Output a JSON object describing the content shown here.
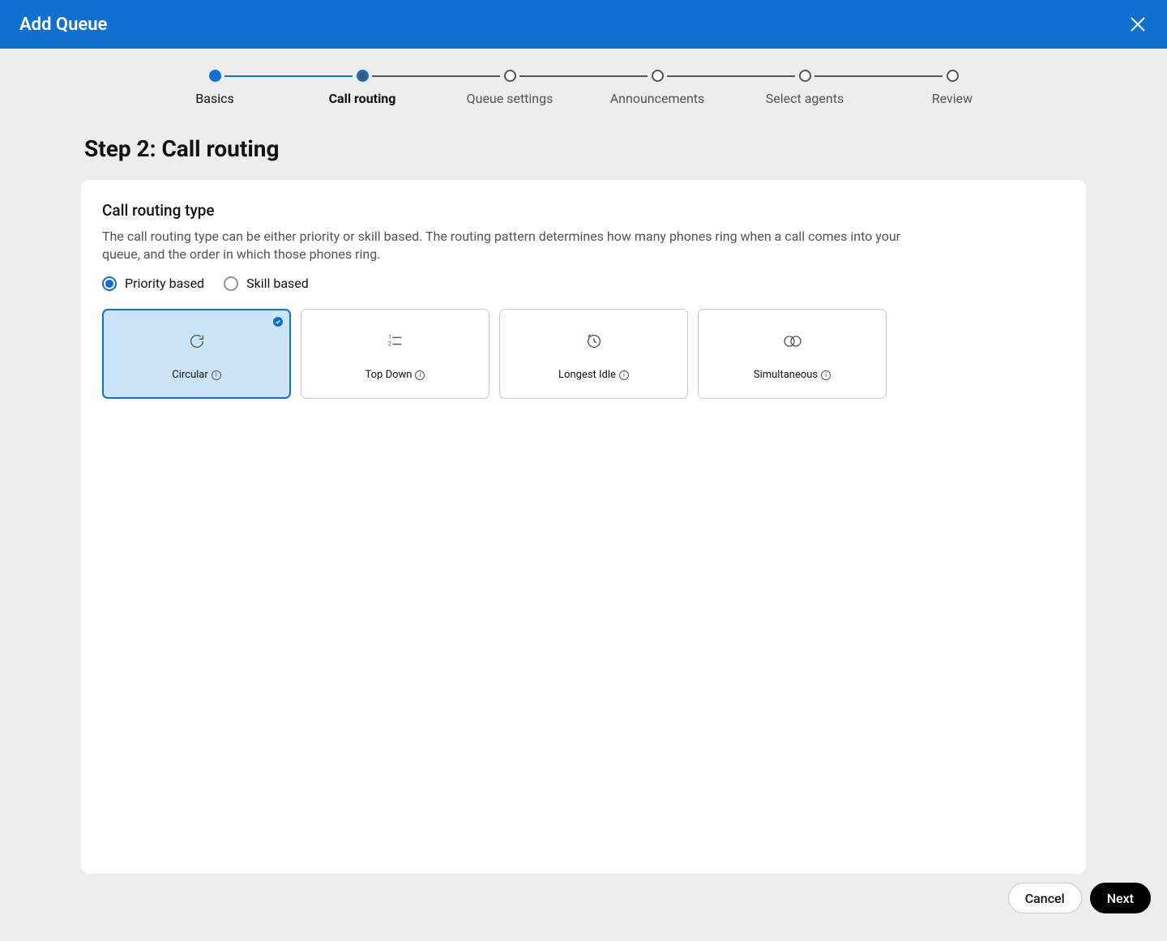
{
  "header": {
    "title": "Add Queue"
  },
  "stepper": {
    "steps": [
      {
        "label": "Basics",
        "state": "completed"
      },
      {
        "label": "Call routing",
        "state": "active"
      },
      {
        "label": "Queue settings",
        "state": "upcoming"
      },
      {
        "label": "Announcements",
        "state": "upcoming"
      },
      {
        "label": "Select agents",
        "state": "upcoming"
      },
      {
        "label": "Review",
        "state": "upcoming"
      }
    ]
  },
  "page": {
    "heading": "Step 2: Call routing"
  },
  "section": {
    "title": "Call routing type",
    "description": "The call routing type can be either priority or skill based. The routing pattern determines how many phones ring when a call comes into your queue, and the order in which those phones ring."
  },
  "routing_basis": {
    "options": [
      {
        "label": "Priority based",
        "selected": true
      },
      {
        "label": "Skill based",
        "selected": false
      }
    ]
  },
  "routing_patterns": [
    {
      "label": "Circular",
      "icon": "circular",
      "selected": true
    },
    {
      "label": "Top Down",
      "icon": "top-down",
      "selected": false
    },
    {
      "label": "Longest Idle",
      "icon": "longest-idle",
      "selected": false
    },
    {
      "label": "Simultaneous",
      "icon": "simultaneous",
      "selected": false
    }
  ],
  "footer": {
    "cancel": "Cancel",
    "next": "Next"
  }
}
